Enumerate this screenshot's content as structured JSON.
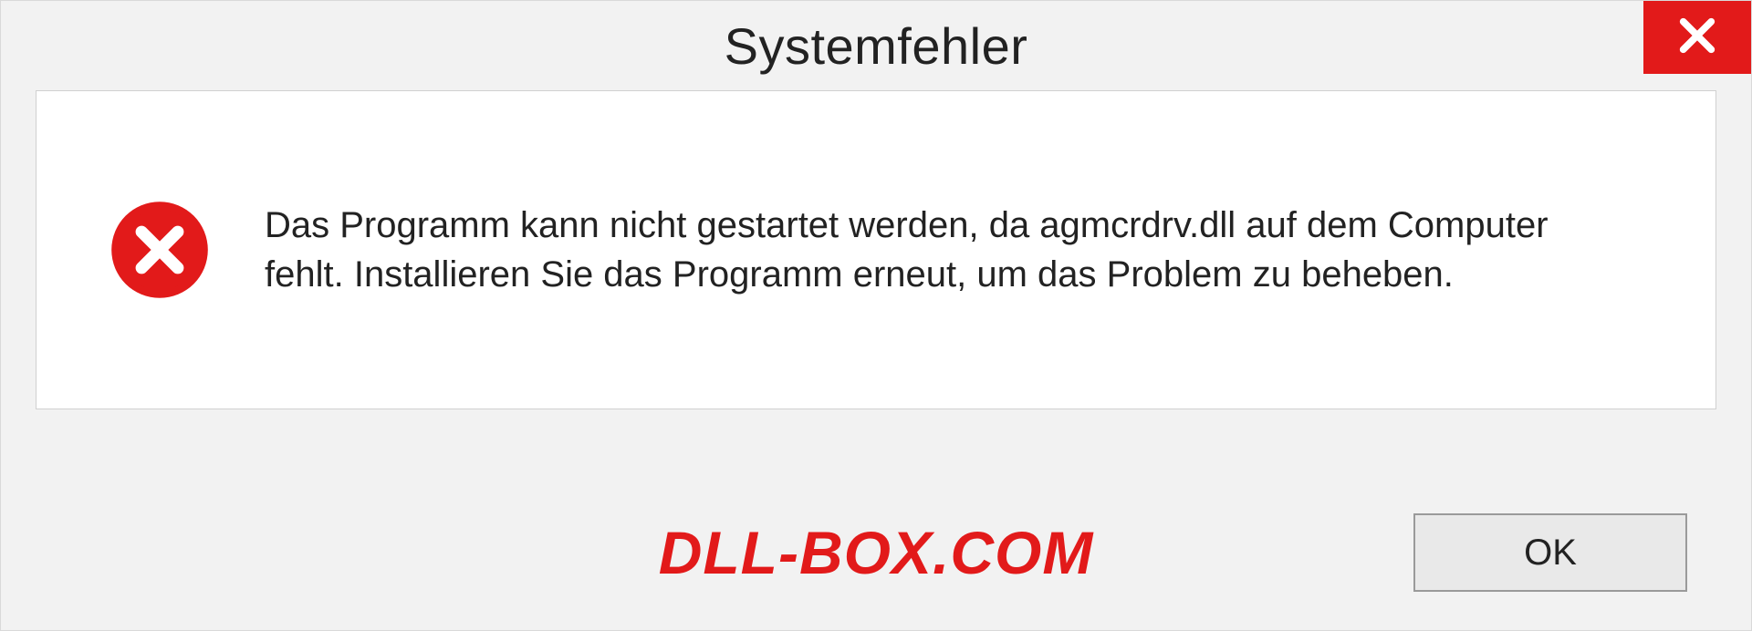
{
  "dialog": {
    "title": "Systemfehler",
    "message": "Das Programm kann nicht gestartet werden, da agmcrdrv.dll auf dem Computer fehlt. Installieren Sie das Programm erneut, um das Problem zu beheben.",
    "ok_label": "OK"
  },
  "watermark": "DLL-BOX.COM"
}
